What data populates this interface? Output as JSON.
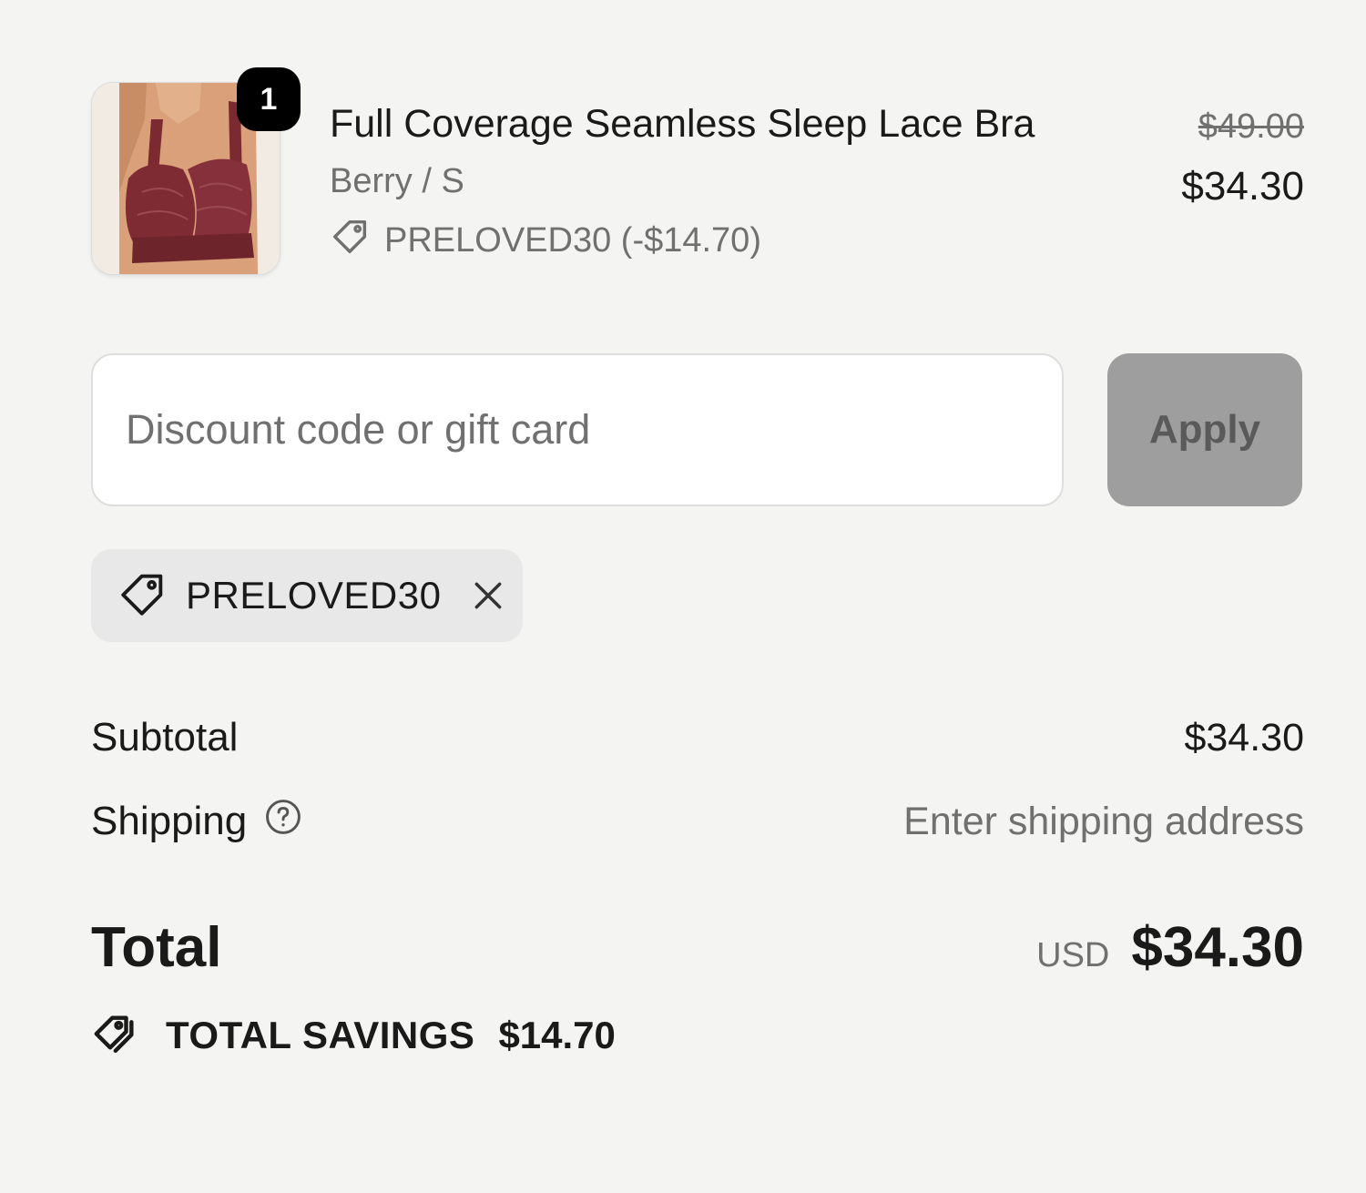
{
  "line_item": {
    "quantity": "1",
    "title": "Full Coverage Seamless Sleep Lace Bra",
    "variant": "Berry / S",
    "discount": "PRELOVED30 (-$14.70)",
    "price_original": "$49.00",
    "price_final": "$34.30",
    "image_icon": "product-photo-bra"
  },
  "discount": {
    "placeholder": "Discount code or gift card",
    "value": "",
    "apply_label": "Apply",
    "applied_code": "PRELOVED30"
  },
  "totals": {
    "subtotal_label": "Subtotal",
    "subtotal_value": "$34.30",
    "shipping_label": "Shipping",
    "shipping_value": "Enter shipping address",
    "total_label": "Total",
    "currency": "USD",
    "total_value": "$34.30",
    "savings_label": "TOTAL SAVINGS",
    "savings_value": "$14.70"
  },
  "colors": {
    "background": "#f4f4f2",
    "text": "#1a1a1a",
    "muted_text": "#707070",
    "apply_button": "#9e9e9e",
    "chip_background": "#e8e8e8",
    "badge": "#000000"
  }
}
